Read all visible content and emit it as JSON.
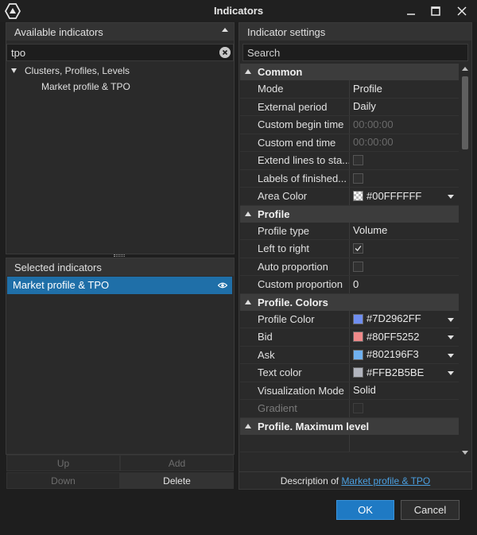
{
  "window": {
    "title": "Indicators",
    "icons": {
      "logo": "platform-logo-icon",
      "minimize": "minimize-icon",
      "maximize": "maximize-icon",
      "close": "close-icon"
    }
  },
  "available": {
    "header": "Available indicators",
    "search_value": "tpo",
    "tree": {
      "group": "Clusters, Profiles, Levels",
      "item": "Market profile & TPO"
    }
  },
  "selected": {
    "header": "Selected indicators",
    "item": "Market profile & TPO"
  },
  "buttons": {
    "up": "Up",
    "add": "Add",
    "down": "Down",
    "delete": "Delete",
    "ok": "OK",
    "cancel": "Cancel"
  },
  "settings": {
    "header": "Indicator settings",
    "search_placeholder": "Search",
    "categories": {
      "common": "Common",
      "profile": "Profile",
      "profile_colors": "Profile. Colors",
      "profile_max": "Profile. Maximum level"
    },
    "common": {
      "mode_label": "Mode",
      "mode_value": "Profile",
      "ext_period_label": "External period",
      "ext_period_value": "Daily",
      "begin_label": "Custom begin time",
      "begin_value": "00:00:00",
      "end_label": "Custom end time",
      "end_value": "00:00:00",
      "extend_label": "Extend lines to sta...",
      "labels_label": "Labels of finished...",
      "area_color_label": "Area Color",
      "area_color_value": "#00FFFFFF"
    },
    "profile": {
      "type_label": "Profile type",
      "type_value": "Volume",
      "ltr_label": "Left to right",
      "auto_label": "Auto proportion",
      "custom_label": "Custom proportion",
      "custom_value": "0"
    },
    "colors": {
      "profile_color_label": "Profile Color",
      "profile_color_value": "#7D2962FF",
      "bid_label": "Bid",
      "bid_value": "#80FF5252",
      "ask_label": "Ask",
      "ask_value": "#802196F3",
      "text_color_label": "Text color",
      "text_color_value": "#FFB2B5BE",
      "vis_mode_label": "Visualization Mode",
      "vis_mode_value": "Solid",
      "gradient_label": "Gradient"
    },
    "description_prefix": "Description of",
    "description_link": "Market profile & TPO"
  },
  "colors": {
    "accent": "#1f7ac4",
    "selection": "#1f6fa8",
    "profile_swatch": "#6f8ef0",
    "bid_swatch": "#f08a8a",
    "ask_swatch": "#6fb1f0",
    "text_swatch": "#b2b5be"
  }
}
